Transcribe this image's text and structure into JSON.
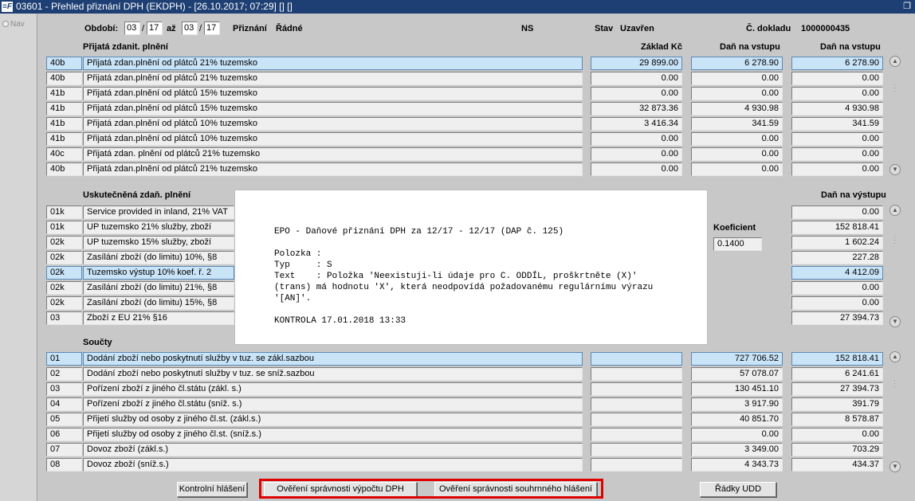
{
  "window": {
    "title": "03601 - Přehled přiznání DPH (EKDPH) - [26.10.2017; 07:29]  []  []",
    "logo": "≡F",
    "restore_glyph": "❐"
  },
  "left": {
    "nav": "Nav"
  },
  "header": {
    "obdobi_label": "Období:",
    "from_month": "03",
    "from_year": "17",
    "az_label": "až",
    "to_month": "03",
    "to_year": "17",
    "slash": "/",
    "priznani_label": "Přiznání",
    "priznani_value": "Řádné",
    "ns": "NS",
    "stav_label": "Stav",
    "stav_value": "Uzavřen",
    "doklad_label": "Č. dokladu",
    "doklad_value": "1000000435"
  },
  "prijata": {
    "title": "Přijatá zdanit. plnění",
    "col_zaklad": "Základ Kč",
    "col_dan_vstup1": "Daň na vstupu",
    "col_dan_vstup2": "Daň na vstupu",
    "rows": [
      {
        "code": "40b",
        "label": "Přijatá zdan.plnění od plátců 21% tuzemsko",
        "zaklad": "29 899.00",
        "dan1": "6 278.90",
        "dan2": "6 278.90"
      },
      {
        "code": "40b",
        "label": "Přijatá zdan.plnění od plátců 21% tuzemsko",
        "zaklad": "0.00",
        "dan1": "0.00",
        "dan2": "0.00"
      },
      {
        "code": "41b",
        "label": "Přijatá zdan.plnění od plátců 15% tuzemsko",
        "zaklad": "0.00",
        "dan1": "0.00",
        "dan2": "0.00"
      },
      {
        "code": "41b",
        "label": "Přijatá zdan.plnění od plátců 15% tuzemsko",
        "zaklad": "32 873.36",
        "dan1": "4 930.98",
        "dan2": "4 930.98"
      },
      {
        "code": "41b",
        "label": "Přijatá zdan.plnění od plátců 10% tuzemsko",
        "zaklad": "3 416.34",
        "dan1": "341.59",
        "dan2": "341.59"
      },
      {
        "code": "41b",
        "label": "Přijatá zdan.plnění od plátců 10% tuzemsko",
        "zaklad": "0.00",
        "dan1": "0.00",
        "dan2": "0.00"
      },
      {
        "code": "40c",
        "label": "Přijatá zdan. plnění od plátců 21% tuzemsko",
        "zaklad": "0.00",
        "dan1": "0.00",
        "dan2": "0.00"
      },
      {
        "code": "40b",
        "label": "Přijatá zdan.plnění od plátců 21% tuzemsko",
        "zaklad": "0.00",
        "dan1": "0.00",
        "dan2": "0.00"
      }
    ]
  },
  "uskutecnena": {
    "title": "Uskutečněná zdaň. plnění",
    "col_dan_vystup": "Daň na výstupu",
    "koeficient_label": "Koeficient",
    "koeficient_value": "0.1400",
    "rows": [
      {
        "code": "01k",
        "label": "Service provided in inland, 21% VAT",
        "dan": "0.00"
      },
      {
        "code": "01k",
        "label": "UP tuzemsko 21% služby, zboží",
        "dan": "152 818.41"
      },
      {
        "code": "02k",
        "label": "UP tuzemsko 15% služby, zboží",
        "dan": "1 602.24"
      },
      {
        "code": "02k",
        "label": "Zasílání zboží (do limitu) 10%, §8",
        "dan": "227.28"
      },
      {
        "code": "02k",
        "label": "Tuzemsko výstup 10% koef. ř. 2",
        "dan": "4 412.09"
      },
      {
        "code": "02k",
        "label": "Zasílání zboží (do limitu) 21%, §8",
        "dan": "0.00"
      },
      {
        "code": "02k",
        "label": "Zasílání zboží (do limitu) 15%, §8",
        "dan": "0.00"
      },
      {
        "code": "03",
        "label": "Zboží z EU 21% §16",
        "dan": "27 394.73"
      }
    ]
  },
  "soucty": {
    "title": "Součty",
    "rows": [
      {
        "code": "01",
        "label": "Dodání zboží nebo poskytnutí služby v tuz. se zákl.sazbou",
        "mid": "",
        "zaklad": "727 706.52",
        "dan": "152 818.41"
      },
      {
        "code": "02",
        "label": "Dodání zboží nebo poskytnutí služby v tuz. se sníž.sazbou",
        "mid": "",
        "zaklad": "57 078.07",
        "dan": "6 241.61"
      },
      {
        "code": "03",
        "label": "Pořízení zboží z jiného čl.státu (zákl. s.)",
        "mid": "",
        "zaklad": "130 451.10",
        "dan": "27 394.73"
      },
      {
        "code": "04",
        "label": "Pořízení zboží z jiného čl.státu (sníž. s.)",
        "mid": "",
        "zaklad": "3 917.90",
        "dan": "391.79"
      },
      {
        "code": "05",
        "label": "Přijetí služby od osoby z jiného čl.st. (zákl.s.)",
        "mid": "",
        "zaklad": "40 851.70",
        "dan": "8 578.87"
      },
      {
        "code": "06",
        "label": "Přijetí služby od osoby z jiného čl.st. (sníž.s.)",
        "mid": "",
        "zaklad": "0.00",
        "dan": "0.00"
      },
      {
        "code": "07",
        "label": "Dovoz zboží (zákl.s.)",
        "mid": "",
        "zaklad": "3 349.00",
        "dan": "703.29"
      },
      {
        "code": "08",
        "label": "Dovoz zboží (sníž.s.)",
        "mid": "",
        "zaklad": "4 343.73",
        "dan": "434.37"
      }
    ]
  },
  "buttons": {
    "kontrolni": "Kontrolní hlášení",
    "overeni_dph": "Ověření správnosti výpočtu DPH",
    "overeni_souhrn": "Ověření správnosti souhrnného hlášení",
    "radky_udd": "Řádky UDD"
  },
  "popup": {
    "text": "EPO - Daňové přiznání DPH za 12/17 - 12/17 (DAP č. 125)\n\nPolozka :\nTyp     : S\nText    : Položka 'Neexistuji-li údaje pro C. ODDÍL, proškrtněte (X)'\n(trans) má hodnotu 'X', která neodpovídá požadovanému regulárnímu výrazu\n'[AN]'.\n\nKONTROLA 17.01.2018 13:33"
  },
  "colors": {
    "titlebar": "#1e3f73",
    "selected_row": "#c9e3f7",
    "highlight_border": "#e00000",
    "background": "#c8c8c8"
  },
  "icons": {
    "scroll_up": "chevron-up-icon",
    "scroll_down": "chevron-down-icon",
    "nav_radio": "radio-icon",
    "restore": "window-restore-icon"
  }
}
